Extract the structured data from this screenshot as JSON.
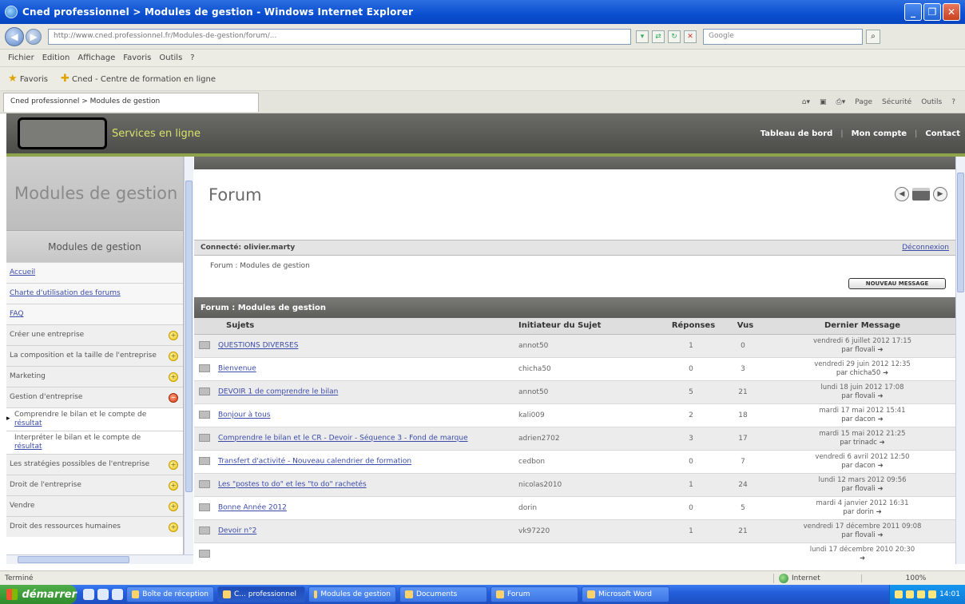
{
  "window": {
    "title": "Cned professionnel > Modules de gestion - Windows Internet Explorer",
    "address": "http://www.cned.professionnel.fr/Modules-de-gestion/forum/...",
    "search_placeholder": "Google",
    "tab_title": "Cned professionnel > Modules de gestion",
    "menu": [
      "Fichier",
      "Edition",
      "Affichage",
      "Favoris",
      "Outils",
      "?"
    ],
    "favorites_label": "Favoris",
    "favorites_link": "Cned - Centre de formation en ligne",
    "commands": [
      "Page",
      "Sécurité",
      "Outils"
    ]
  },
  "site": {
    "services_label": "Services en ligne",
    "header_links": [
      "Tableau de bord",
      "Mon compte",
      "Contact"
    ]
  },
  "sidebar": {
    "title": "Modules de gestion",
    "subtitle": "Modules de gestion",
    "items": [
      {
        "label": "Accueil",
        "type": "link"
      },
      {
        "label": "Charte d'utilisation des forums",
        "type": "link"
      },
      {
        "label": "FAQ",
        "type": "link"
      },
      {
        "label": "Créer une entreprise",
        "type": "item"
      },
      {
        "label": "La composition et la taille de l'entreprise",
        "type": "item"
      },
      {
        "label": "Marketing",
        "type": "item"
      },
      {
        "label": "Gestion d'entreprise",
        "type": "item"
      },
      {
        "label": "Comprendre le bilan et le compte de",
        "link": "résultat",
        "type": "sub"
      },
      {
        "label": "Interpréter le bilan et le compte de",
        "link": "résultat",
        "type": "sub"
      },
      {
        "label": "Les stratégies possibles de l'entreprise",
        "type": "item"
      },
      {
        "label": "Droit de l'entreprise",
        "type": "item"
      },
      {
        "label": "Vendre",
        "type": "item"
      },
      {
        "label": "Droit des ressources humaines",
        "type": "item"
      }
    ]
  },
  "main": {
    "page_title": "Forum",
    "connected_label": "Connecté: olivier.marty",
    "logout_link": "Déconnexion",
    "breadcrumb": "Forum : Modules de gestion",
    "new_message_button": "NOUVEAU MESSAGE",
    "forum_bar_title": "Forum : Modules de gestion",
    "columns": [
      "Sujets",
      "Initiateur du Sujet",
      "Réponses",
      "Vus",
      "Dernier Message"
    ],
    "topics": [
      {
        "subject": "QUESTIONS DIVERSES",
        "author": "annot50",
        "replies": "1",
        "views": "0",
        "last_date": "vendredi 6 juillet 2012 17:15",
        "last_by": "par flovali"
      },
      {
        "subject": "Bienvenue",
        "author": "chicha50",
        "replies": "0",
        "views": "3",
        "last_date": "vendredi 29 juin 2012 12:35",
        "last_by": "par chicha50"
      },
      {
        "subject": "DEVOIR 1 de comprendre le bilan",
        "author": "annot50",
        "replies": "5",
        "views": "21",
        "last_date": "lundi 18 juin 2012 17:08",
        "last_by": "par flovali"
      },
      {
        "subject": "Bonjour à tous",
        "author": "kali009",
        "replies": "2",
        "views": "18",
        "last_date": "mardi 17 mai 2012 15:41",
        "last_by": "par dacon"
      },
      {
        "subject": "Comprendre le bilan et le CR - Devoir - Séquence 3 - Fond de marque",
        "author": "adrien2702",
        "replies": "3",
        "views": "17",
        "last_date": "mardi 15 mai 2012 21:25",
        "last_by": "par trinadc"
      },
      {
        "subject": "Transfert d'activité - Nouveau calendrier de formation",
        "author": "cedbon",
        "replies": "0",
        "views": "7",
        "last_date": "vendredi 6 avril 2012 12:50",
        "last_by": "par dacon"
      },
      {
        "subject": "Les \"postes to do\" et les \"to do\" rachetés",
        "author": "nicolas2010",
        "replies": "1",
        "views": "24",
        "last_date": "lundi 12 mars 2012 09:56",
        "last_by": "par flovali"
      },
      {
        "subject": "Bonne Année 2012",
        "author": "dorin",
        "replies": "0",
        "views": "5",
        "last_date": "mardi 4 janvier 2012 16:31",
        "last_by": "par dorin"
      },
      {
        "subject": "Devoir n°2",
        "author": "vk97220",
        "replies": "1",
        "views": "21",
        "last_date": "vendredi 17 décembre 2011 09:08",
        "last_by": "par flovali"
      },
      {
        "subject": "",
        "author": "",
        "replies": "",
        "views": "",
        "last_date": "lundi 17 décembre 2010 20:30",
        "last_by": ""
      }
    ]
  },
  "status": {
    "left": "Terminé",
    "zone": "Internet",
    "zoom": "100%"
  },
  "taskbar": {
    "start": "démarrer",
    "tasks": [
      "Boîte de réception",
      "C... professionnel",
      "Modules de gestion",
      "Documents",
      "Forum"
    ],
    "tray_items": [
      "Microsoft Word"
    ],
    "clock": "14:01"
  }
}
